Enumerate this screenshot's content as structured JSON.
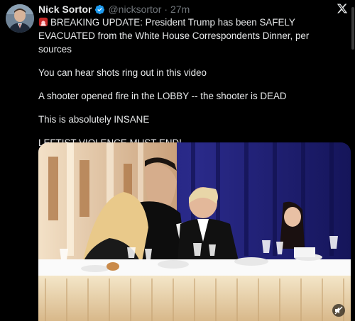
{
  "tweet": {
    "author": {
      "display_name": "Nick Sortor",
      "handle": "@nicksortor",
      "separator": "·",
      "time": "27m",
      "verified": true,
      "avatar_icon": "profile-photo"
    },
    "platform_icon": "x-logo-icon",
    "lines": [
      "BREAKING UPDATE: President Trump has been SAFELY EVACUATED from the White House Correspondents Dinner, per sources",
      "You can hear shots ring out in this video",
      "A shooter opened fire in the LOBBY -- the shooter is DEAD",
      "This is absolutely INSANE",
      "LEFTIST VIOLENCE MUST END!"
    ],
    "emoji_icon": "siren-icon",
    "media": {
      "type": "video",
      "controls_icon": "mute-icon"
    }
  },
  "colors": {
    "background": "#000000",
    "text": "#e7e9ea",
    "muted": "#71767b",
    "verified": "#1d9bf0"
  }
}
